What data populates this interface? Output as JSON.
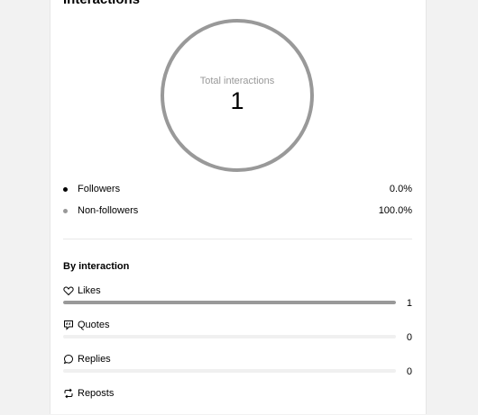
{
  "section": {
    "title": "Interactions"
  },
  "donut": {
    "label": "Total interactions",
    "value": "1",
    "ring_color": "#999999"
  },
  "legend": [
    {
      "label": "Followers",
      "percent": "0.0%",
      "color": "#000000"
    },
    {
      "label": "Non-followers",
      "percent": "100.0%",
      "color": "#999999"
    }
  ],
  "by_interaction": {
    "title": "By interaction",
    "items": [
      {
        "icon": "heart-icon",
        "label": "Likes",
        "count": "1",
        "fraction": 1.0
      },
      {
        "icon": "quote-icon",
        "label": "Quotes",
        "count": "0",
        "fraction": 0.0
      },
      {
        "icon": "reply-icon",
        "label": "Replies",
        "count": "0",
        "fraction": 0.0
      },
      {
        "icon": "repost-icon",
        "label": "Reposts",
        "count": "",
        "fraction": 0.0
      }
    ]
  }
}
